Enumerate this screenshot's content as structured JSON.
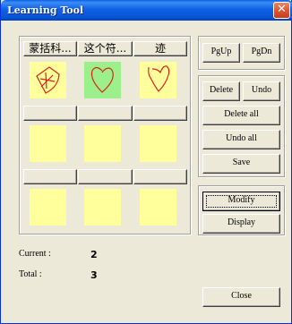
{
  "window": {
    "title": "Learning Tool",
    "close_glyph": "✕"
  },
  "grid": {
    "header_rows": [
      [
        "蒙括科...",
        "这个符...",
        "迹"
      ],
      [
        "",
        "",
        ""
      ],
      [
        "",
        "",
        ""
      ]
    ],
    "selected_cell": 1,
    "cell_color": "#ffff9c",
    "selected_color": "#9cf08c",
    "stroke_color": "#e02020",
    "drawings": [
      "star-in-shape-drawing",
      "heart-drawing",
      "heart-drawing"
    ]
  },
  "nav": {
    "pgup": "PgUp",
    "pgdn": "PgDn"
  },
  "edit": {
    "delete": "Delete",
    "undo": "Undo",
    "delete_all": "Delete all",
    "undo_all": "Undo all",
    "save": "Save"
  },
  "mode": {
    "modify": "Modify",
    "display": "Display"
  },
  "status": {
    "current_label": "Current :",
    "current_value": "2",
    "total_label": "Total :",
    "total_value": "3"
  },
  "footer": {
    "close": "Close"
  }
}
